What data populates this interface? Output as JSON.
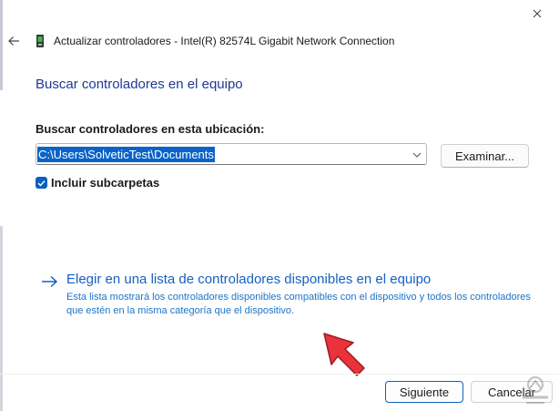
{
  "window": {
    "title": "Actualizar controladores - Intel(R) 82574L Gigabit Network Connection"
  },
  "main": {
    "heading": "Buscar controladores en el equipo",
    "location_label": "Buscar controladores en esta ubicación:",
    "path_value": "C:\\Users\\SolveticTest\\Documents",
    "browse_label": "Examinar...",
    "include_subfolders_label": "Incluir subcarpetas",
    "include_subfolders_checked": true
  },
  "option": {
    "title": "Elegir en una lista de controladores disponibles en el equipo",
    "description": "Esta lista mostrará los controladores disponibles compatibles con el dispositivo y todos los controladores que estén en la misma categoría que el dispositivo."
  },
  "footer": {
    "next_label": "Siguiente",
    "cancel_label": "Cancelar"
  },
  "icons": {
    "close": "close-icon",
    "back": "back-arrow-icon",
    "device": "network-device-icon",
    "option_arrow": "arrow-right-icon",
    "annotation": "red-pointer-arrow-icon",
    "watermark": "watermark-logo-icon"
  },
  "colors": {
    "accent": "#0a5fbf",
    "heading": "#1f3a93",
    "link": "#1761bf",
    "annotation": "#e8323c"
  }
}
